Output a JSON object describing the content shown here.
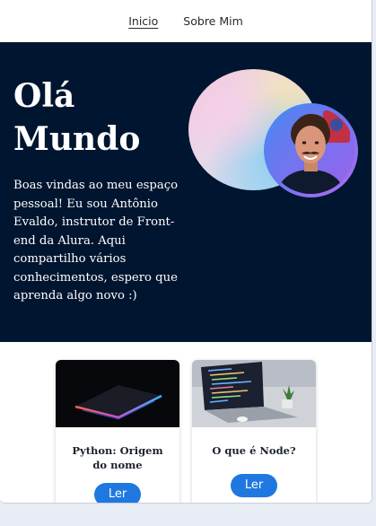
{
  "nav": {
    "items": [
      {
        "label": "Inicio",
        "active": true
      },
      {
        "label": "Sobre Mim",
        "active": false
      }
    ]
  },
  "hero": {
    "title": "Olá Mundo",
    "text": "Boas vindas ao meu espaço pessoal! Eu sou Antônio Evaldo, instrutor de Front-end da Alura. Aqui compartilho vários conhecimentos, espero que aprenda algo novo :)",
    "background": "#00152f"
  },
  "cards": [
    {
      "title": "Python: Origem do nome",
      "button": "Ler",
      "image": "laptop-closed-image"
    },
    {
      "title": "O que é Node?",
      "button": "Ler",
      "image": "laptop-code-image"
    }
  ],
  "colors": {
    "accent": "#1f78e0",
    "hero_bg": "#00152f",
    "page_bg": "#e8ecf4"
  }
}
